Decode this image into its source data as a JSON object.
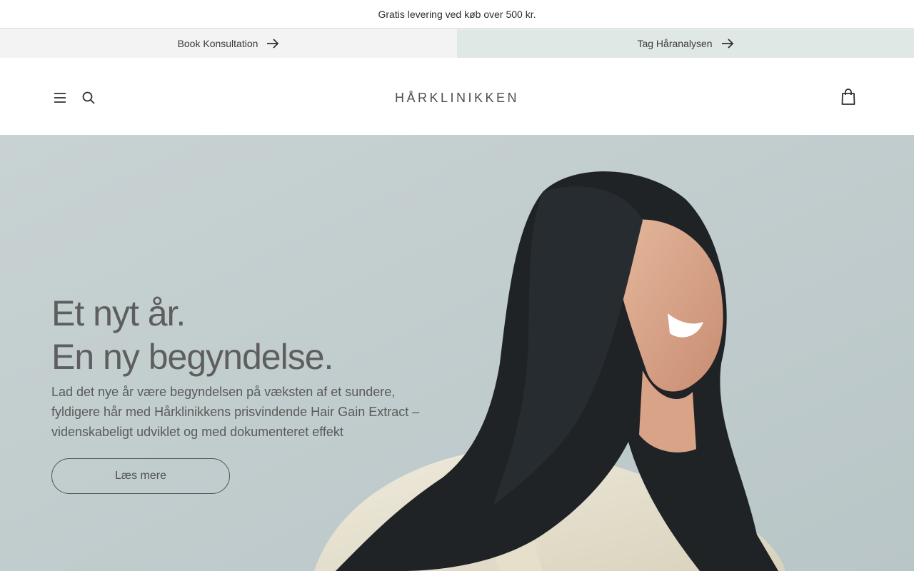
{
  "announcement": {
    "text": "Gratis levering ved køb over 500 kr."
  },
  "ctas": {
    "left": {
      "label": "Book Konsultation",
      "icon": "arrow-right-icon"
    },
    "right": {
      "label": "Tag Håranalysen",
      "icon": "arrow-right-icon"
    }
  },
  "header": {
    "logo": "HÅRKLINIKKEN",
    "menu_icon": "hamburger-menu-icon",
    "search_icon": "search-icon",
    "cart_icon": "shopping-bag-icon"
  },
  "hero": {
    "title_line1": "Et nyt år.",
    "title_line2": "En ny begyndelse.",
    "body": "Lad det nye år være begyndelsen på væksten af et sundere, fyldigere hår med Hårklinikkens prisvindende Hair Gain Extract – videnskabeligt udviklet og med dokumenteret effekt",
    "button_label": "Læs mere"
  },
  "colors": {
    "cta_left_bg": "#f3f3f3",
    "cta_right_bg": "#e0e8e6",
    "hero_bg": "#c3cecf",
    "text": "#5e5e5e"
  }
}
